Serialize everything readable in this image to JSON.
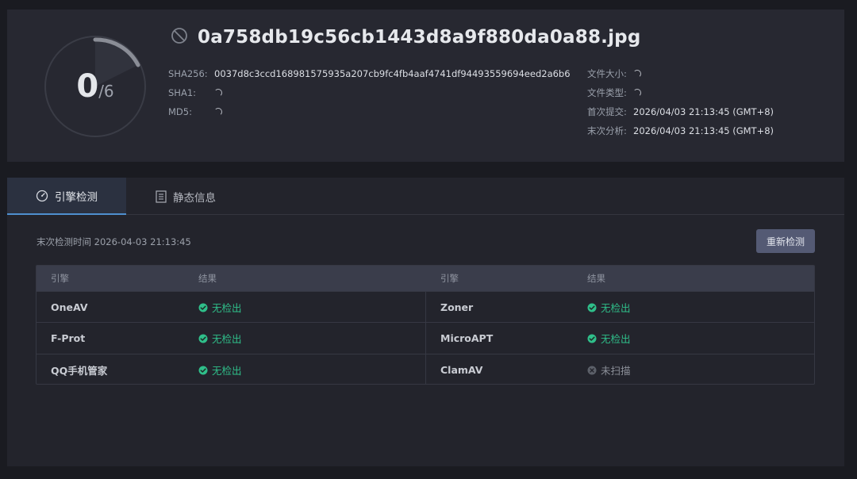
{
  "header": {
    "score": "0",
    "score_total": "/6",
    "file_name": "0a758db19c56cb1443d8a9f880da0a88.jpg",
    "sha256_label": "SHA256:",
    "sha256_value": "0037d8c3ccd168981575935a207cb9fc4fb4aaf4741df94493559694eed2a6b6",
    "sha1_label": "SHA1:",
    "md5_label": "MD5:",
    "file_size_label": "文件大小:",
    "file_type_label": "文件类型:",
    "first_submit_label": "首次提交:",
    "first_submit_value": "2026/04/03 21:13:45 (GMT+8)",
    "last_analysis_label": "末次分析:",
    "last_analysis_value": "2026/04/03 21:13:45 (GMT+8)"
  },
  "tabs": {
    "engine": "引擎检测",
    "static": "静态信息"
  },
  "scan": {
    "last_scan_text": "末次检测时间 2026-04-03 21:13:45",
    "rescan_label": "重新检测"
  },
  "table": {
    "col_engine": "引擎",
    "col_result": "结果",
    "rows": [
      {
        "left_engine": "OneAV",
        "left_result": "无检出",
        "left_status": "clean",
        "right_engine": "Zoner",
        "right_result": "无检出",
        "right_status": "clean"
      },
      {
        "left_engine": "F-Prot",
        "left_result": "无检出",
        "left_status": "clean",
        "right_engine": "MicroAPT",
        "right_result": "无检出",
        "right_status": "clean"
      },
      {
        "left_engine": "QQ手机管家",
        "left_result": "无检出",
        "left_status": "clean",
        "right_engine": "ClamAV",
        "right_result": "未扫描",
        "right_status": "unscanned"
      }
    ]
  },
  "colors": {
    "accent": "#4e8fcf",
    "clean": "#2fbf8a",
    "unscanned": "#8b8f98",
    "button": "#545a74"
  },
  "icons": {
    "title": "spinner-icon",
    "tab_engine": "gauge-icon",
    "tab_static": "document-icon",
    "clean": "check-circle-icon",
    "unscanned": "x-circle-icon"
  }
}
